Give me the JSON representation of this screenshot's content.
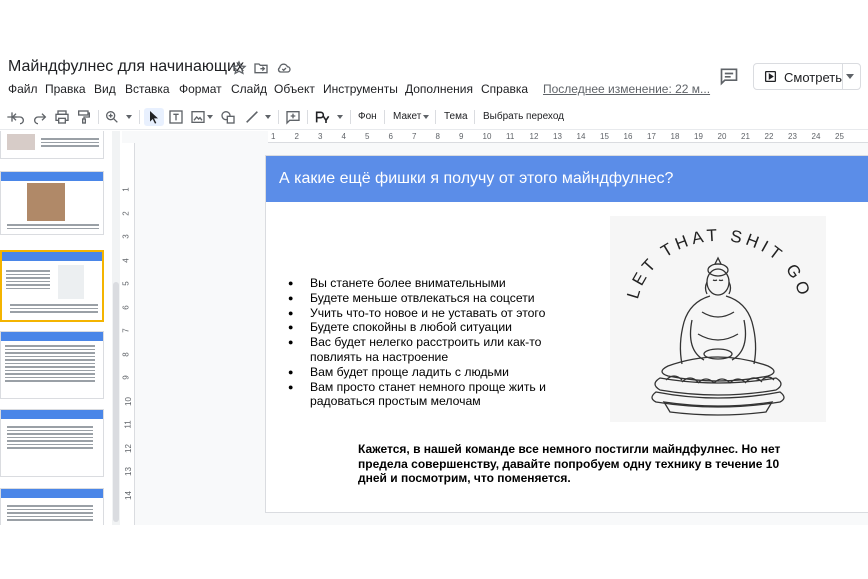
{
  "document": {
    "title": "Майндфулнес для начинающих"
  },
  "menu": {
    "items": [
      "Файл",
      "Правка",
      "Вид",
      "Вставка",
      "Формат",
      "Слайд",
      "Объект",
      "Инструменты",
      "Дополнения",
      "Справка"
    ],
    "last_edit": "Последнее изменение: 22 м..."
  },
  "header_actions": {
    "present_label": "Смотреть"
  },
  "toolbar": {
    "background_label": "Фон",
    "layout_label": "Макет",
    "theme_label": "Тема",
    "transition_label": "Выбрать переход"
  },
  "ruler": {
    "top": [
      "1",
      "2",
      "3",
      "4",
      "5",
      "6",
      "7",
      "8",
      "9",
      "10",
      "11",
      "12",
      "13",
      "14",
      "15",
      "16",
      "17",
      "18",
      "19",
      "20",
      "21",
      "22",
      "23",
      "24",
      "25"
    ],
    "left": [
      "1",
      "2",
      "3",
      "4",
      "5",
      "6",
      "7",
      "8",
      "9",
      "10",
      "11",
      "12",
      "13",
      "14"
    ]
  },
  "slide": {
    "title": "А какие ещё фишки я получу от этого майндфулнес?",
    "bullets": [
      "Вы станете более внимательными",
      "Будете меньше отвлекаться на соцсети",
      "Учить что-то новое и не уставать от этого",
      "Будете спокойны в любой ситуации",
      "Вас будет нелегко расстроить или как-то повлиять на настроение",
      "Вам будет проще ладить с людьми",
      "Вам просто станет немного проще жить и радоваться простым мелочам"
    ],
    "image_caption": "LET THAT SHIT GO",
    "conclusion": "Кажется, в нашей команде все немного постигли майндфулнес. Но нет предела совершенству, давайте попробуем одну технику в течение 10 дней и посмотрим, что поменяется."
  },
  "colors": {
    "slide_header": "#5b8de8",
    "thumb_header": "#4a86e8",
    "selected_thumb_border": "#f4b400"
  }
}
